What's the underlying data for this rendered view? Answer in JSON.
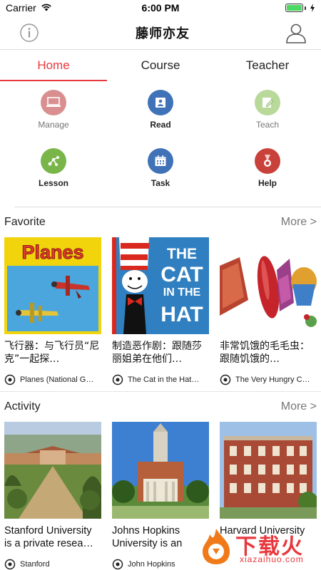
{
  "status_bar": {
    "carrier": "Carrier",
    "time": "6:00 PM",
    "wifi_icon": "wifi-icon",
    "battery_icon": "battery-icon",
    "battery_level": 1.0
  },
  "nav": {
    "title": "藤师亦友",
    "left_icon": "info-icon",
    "right_icon": "user-profile-icon"
  },
  "tabs": [
    {
      "label": "Home",
      "active": true
    },
    {
      "label": "Course",
      "active": false
    },
    {
      "label": "Teacher",
      "active": false
    }
  ],
  "grid": [
    {
      "label": "Manage",
      "icon": "monitor-icon",
      "color": "#d98f8f",
      "emphasis": false
    },
    {
      "label": "Read",
      "icon": "read-book-icon",
      "color": "#3f72b7",
      "emphasis": true
    },
    {
      "label": "Teach",
      "icon": "edit-note-icon",
      "color": "#b8d99a",
      "emphasis": false
    },
    {
      "label": "Lesson",
      "icon": "molecule-icon",
      "color": "#7ab54a",
      "emphasis": true
    },
    {
      "label": "Task",
      "icon": "calendar-icon",
      "color": "#3f72b7",
      "emphasis": true
    },
    {
      "label": "Help",
      "icon": "medal-icon",
      "color": "#c9413b",
      "emphasis": true
    }
  ],
  "favorite": {
    "title": "Favorite",
    "more": "More >",
    "items": [
      {
        "title": "飞行器：与飞行员“尼克”一起探…",
        "meta": "Planes (National G…",
        "image": "planes-book-cover"
      },
      {
        "title": "制造恶作剧：跟随莎丽姐弟在他们…",
        "meta": "The Cat in the Hat…",
        "image": "cat-in-the-hat-book-cover"
      },
      {
        "title": "非常饥饿的毛毛虫：跟随饥饿的…",
        "meta": "The Very Hungry C…",
        "image": "hungry-caterpillar-book-cover"
      }
    ]
  },
  "activity": {
    "title": "Activity",
    "more": "More >",
    "items": [
      {
        "title": "Stanford University is a private resea…",
        "meta": "Stanford",
        "image": "stanford-campus-photo"
      },
      {
        "title": "Johns Hopkins University is an",
        "meta": "John Hopkins",
        "image": "johns-hopkins-building-photo"
      },
      {
        "title": "Harvard University",
        "meta": "",
        "image": "harvard-building-photo"
      }
    ]
  },
  "watermark": {
    "main": "下载火",
    "sub": "xiazaihuo.com"
  },
  "colors": {
    "accent": "#e8383d",
    "muted_text": "#777777",
    "divider": "#dddddd"
  }
}
